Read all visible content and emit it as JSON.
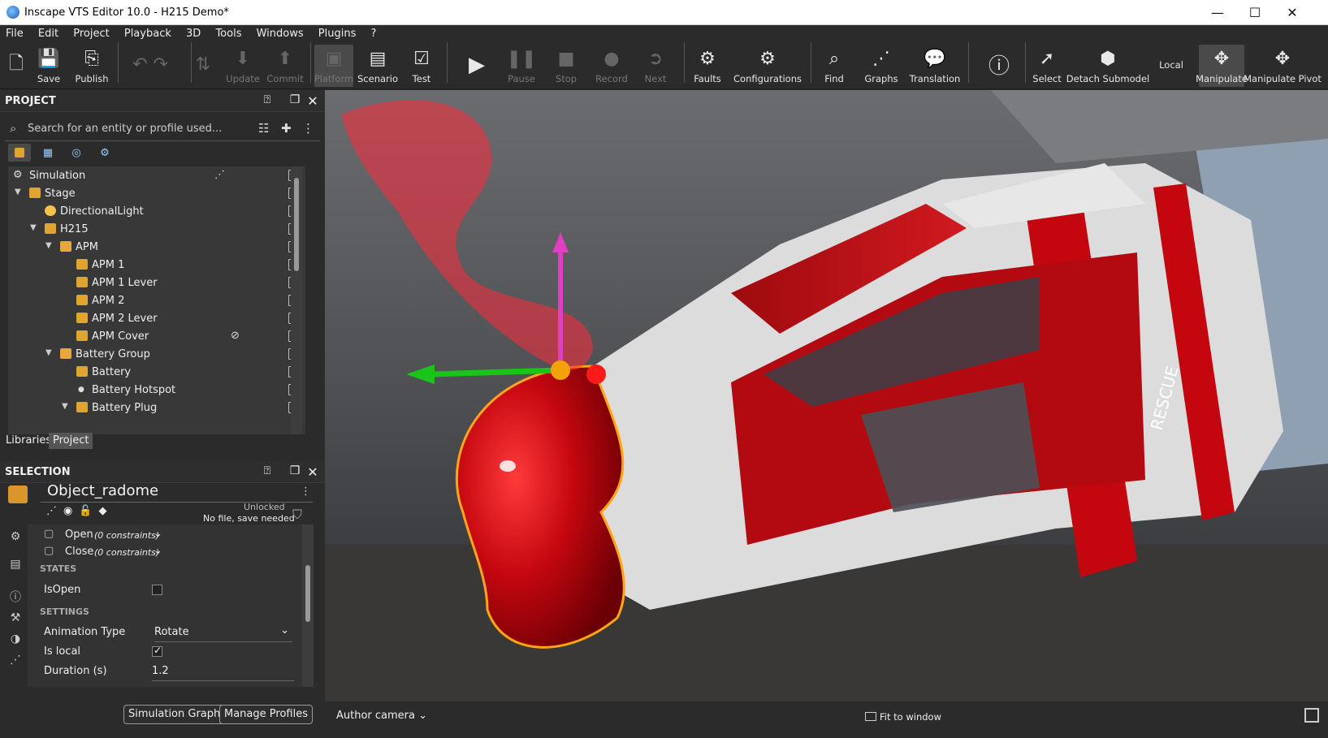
{
  "window": {
    "title": "Inscape VTS Editor 10.0 - H215 Demo*"
  },
  "menu": [
    "File",
    "Edit",
    "Project",
    "Playback",
    "3D",
    "Tools",
    "Windows",
    "Plugins",
    "?"
  ],
  "toolbar": {
    "new": "",
    "save": "Save",
    "publish": "Publish",
    "update": "Update",
    "commit": "Commit",
    "platform": "Platform",
    "scenario": "Scenario",
    "test": "Test",
    "pause": "Pause",
    "stop": "Stop",
    "record": "Record",
    "next": "Next",
    "faults": "Faults",
    "configurations": "Configurations",
    "find": "Find",
    "graphs": "Graphs",
    "translation": "Translation",
    "select": "Select",
    "detach_submodel": "Detach Submodel",
    "space": "Local",
    "manipulate": "Manipulate",
    "manipulate_pivot": "Manipulate Pivot"
  },
  "project": {
    "title": "PROJECT",
    "search_placeholder": "Search for an entity or profile used...",
    "tree": [
      {
        "label": "Simulation",
        "level": 0,
        "arrow": "",
        "icon": "gear"
      },
      {
        "label": "Stage",
        "level": 0,
        "arrow": "⌄",
        "icon": "cube"
      },
      {
        "label": "DirectionalLight",
        "level": 1,
        "arrow": "",
        "icon": "light"
      },
      {
        "label": "H215",
        "level": 1,
        "arrow": "⌄",
        "icon": "cube"
      },
      {
        "label": "APM",
        "level": 2,
        "arrow": "⌄",
        "icon": "folder"
      },
      {
        "label": "APM 1",
        "level": 3,
        "arrow": "",
        "icon": "cube"
      },
      {
        "label": "APM 1 Lever",
        "level": 3,
        "arrow": "",
        "icon": "cube"
      },
      {
        "label": "APM 2",
        "level": 3,
        "arrow": "",
        "icon": "cube"
      },
      {
        "label": "APM 2 Lever",
        "level": 3,
        "arrow": "",
        "icon": "cube"
      },
      {
        "label": "APM Cover",
        "level": 3,
        "arrow": "",
        "icon": "cube"
      },
      {
        "label": "Battery Group",
        "level": 2,
        "arrow": "⌄",
        "icon": "folder"
      },
      {
        "label": "Battery",
        "level": 3,
        "arrow": "",
        "icon": "cube"
      },
      {
        "label": "Battery Hotspot",
        "level": 3,
        "arrow": "",
        "icon": "dot"
      },
      {
        "label": "Battery Plug",
        "level": 3,
        "arrow": "⌄",
        "icon": "cube"
      }
    ],
    "tabs": [
      "Libraries",
      "Project"
    ]
  },
  "selection": {
    "title": "SELECTION",
    "object_name": "Object_radome",
    "lock_status": "Unlocked",
    "file_status": "No file, save needed",
    "open_label": "Open",
    "open_constraints": "(0 constraints)",
    "close_label": "Close",
    "close_constraints": "(0 constraints)",
    "states_header": "STATES",
    "is_open_label": "IsOpen",
    "is_open": false,
    "settings_header": "SETTINGS",
    "animation_type_label": "Animation Type",
    "animation_type": "Rotate",
    "is_local_label": "Is local",
    "is_local": true,
    "duration_label": "Duration (s)",
    "duration": "1.2",
    "simulation_graph_button": "Simulation Graph",
    "manage_profiles_button": "Manage Profiles"
  },
  "viewport": {
    "camera": "Author camera",
    "fit": "Fit to window",
    "rescue_text": "RESCUE"
  },
  "colors": {
    "accent_orange": "#e0a431",
    "gizmo_y": "#e040c0",
    "gizmo_x": "#19c519",
    "gizmo_rotation": "#ff2a3a",
    "fuselage_red": "#c4070f"
  }
}
